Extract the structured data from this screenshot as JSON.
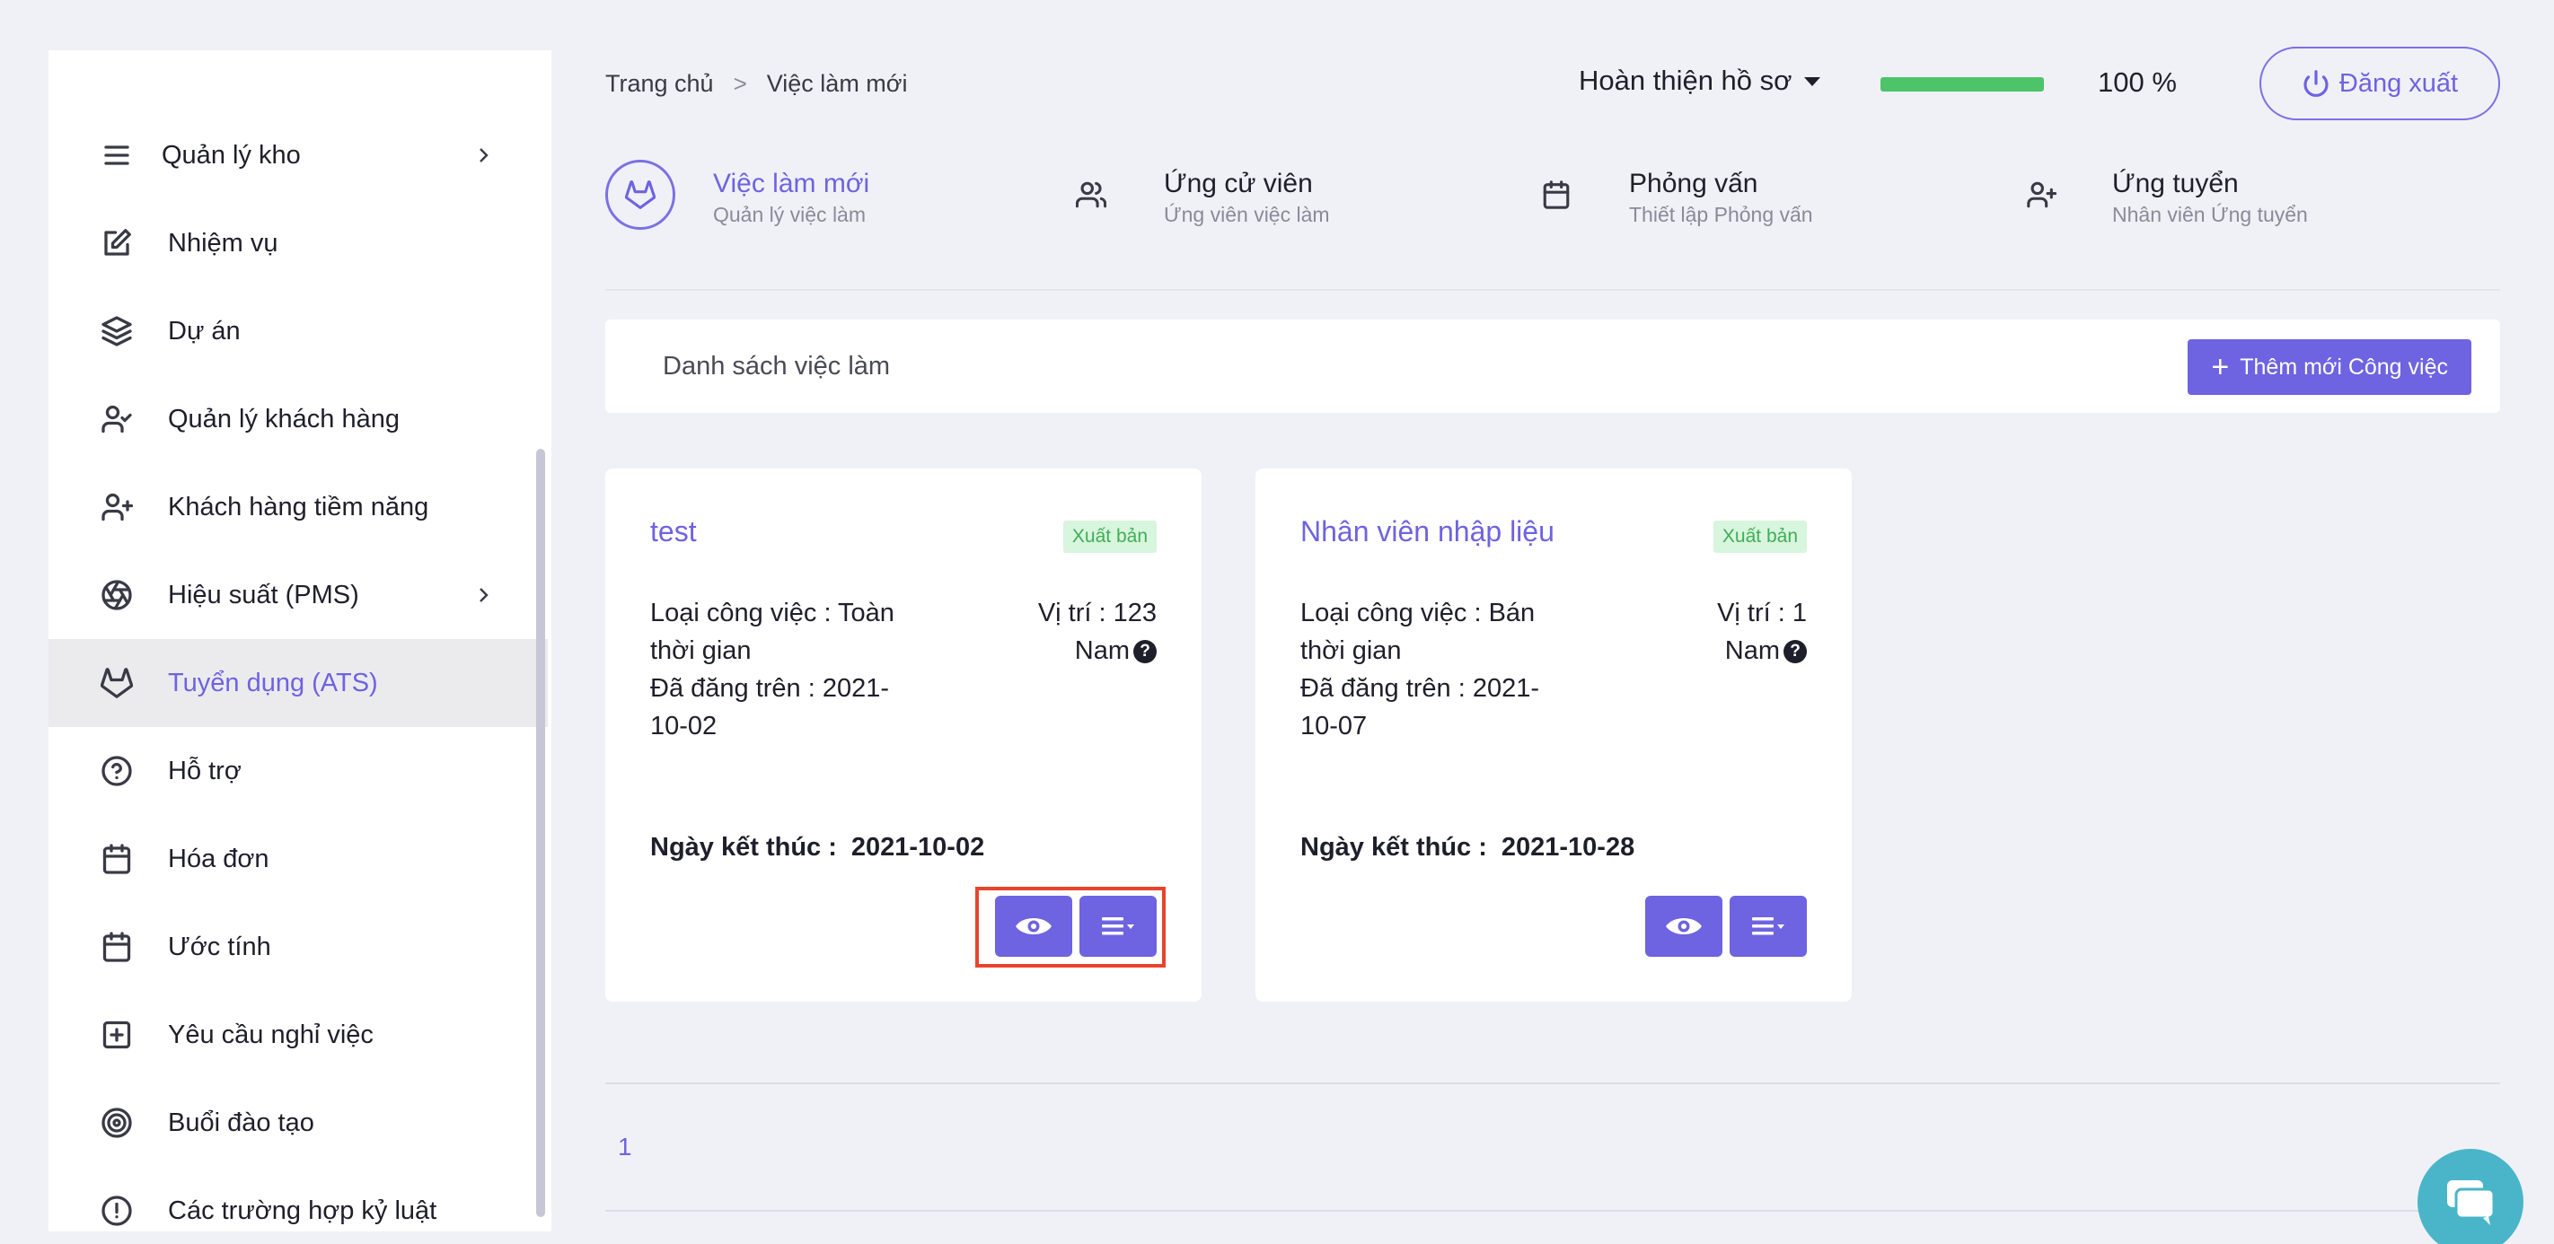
{
  "sidebar": {
    "items": [
      {
        "label": "Quản lý kho",
        "icon": "list-icon",
        "chevron": true
      },
      {
        "label": "Nhiệm vụ",
        "icon": "edit-icon",
        "chevron": false
      },
      {
        "label": "Dự án",
        "icon": "layers-icon",
        "chevron": false
      },
      {
        "label": "Quản lý khách hàng",
        "icon": "user-check-icon",
        "chevron": false
      },
      {
        "label": "Khách hàng tiềm năng",
        "icon": "user-plus-icon",
        "chevron": false
      },
      {
        "label": "Hiệu suất (PMS)",
        "icon": "aperture-icon",
        "chevron": true
      },
      {
        "label": "Tuyển dụng (ATS)",
        "icon": "gitlab-icon",
        "chevron": false,
        "active": true
      },
      {
        "label": "Hỗ trợ",
        "icon": "help-circle-icon",
        "chevron": false
      },
      {
        "label": "Hóa đơn",
        "icon": "calendar-icon",
        "chevron": false
      },
      {
        "label": "Ước tính",
        "icon": "calendar-icon",
        "chevron": false
      },
      {
        "label": "Yêu cầu nghỉ việc",
        "icon": "plus-square-icon",
        "chevron": false
      },
      {
        "label": "Buổi đào tạo",
        "icon": "target-icon",
        "chevron": false
      },
      {
        "label": "Các trường hợp kỷ luật",
        "icon": "alert-circle-icon",
        "chevron": false
      }
    ]
  },
  "header": {
    "breadcrumb": {
      "home": "Trang chủ",
      "separator": ">",
      "current": "Việc làm mới"
    },
    "profile_dropdown": "Hoàn thiện hồ sơ",
    "progress_value": 100,
    "progress_text": "100 %",
    "logout_label": "Đăng xuất"
  },
  "tabs": [
    {
      "title": "Việc làm mới",
      "subtitle": "Quản lý việc làm",
      "icon": "gitlab-icon",
      "active": true
    },
    {
      "title": "Ứng cử viên",
      "subtitle": "Ứng viên việc làm",
      "icon": "users-icon"
    },
    {
      "title": "Phỏng vấn",
      "subtitle": "Thiết lập Phỏng vấn",
      "icon": "calendar-icon"
    },
    {
      "title": "Ứng tuyển",
      "subtitle": "Nhân viên Ứng tuyển",
      "icon": "user-plus-icon"
    }
  ],
  "panel": {
    "title": "Danh sách việc làm",
    "add_button": "Thêm mới Công việc"
  },
  "jobs": [
    {
      "title": "test",
      "badge": "Xuất bản",
      "type_line1": "Loại công việc : Toàn",
      "type_line2": "thời gian",
      "posted_line1": "Đã đăng trên : 2021-",
      "posted_line2": "10-02",
      "position_line1": "Vị trí : 123",
      "position_line2": "Nam",
      "end_label": "Ngày kết thúc :",
      "end_date": "2021-10-02"
    },
    {
      "title": "Nhân viên nhập liệu",
      "badge": "Xuất bản",
      "type_line1": "Loại công việc : Bán",
      "type_line2": "thời gian",
      "posted_line1": "Đã đăng trên : 2021-",
      "posted_line2": "10-07",
      "position_line1": "Vị trí : 1",
      "position_line2": "Nam",
      "end_label": "Ngày kết thúc :",
      "end_date": "2021-10-28"
    }
  ],
  "pagination": {
    "current": "1"
  },
  "colors": {
    "accent": "#6e63e0",
    "success": "#4dc46a",
    "highlight": "#e8442c",
    "chat": "#4ab5c9"
  }
}
